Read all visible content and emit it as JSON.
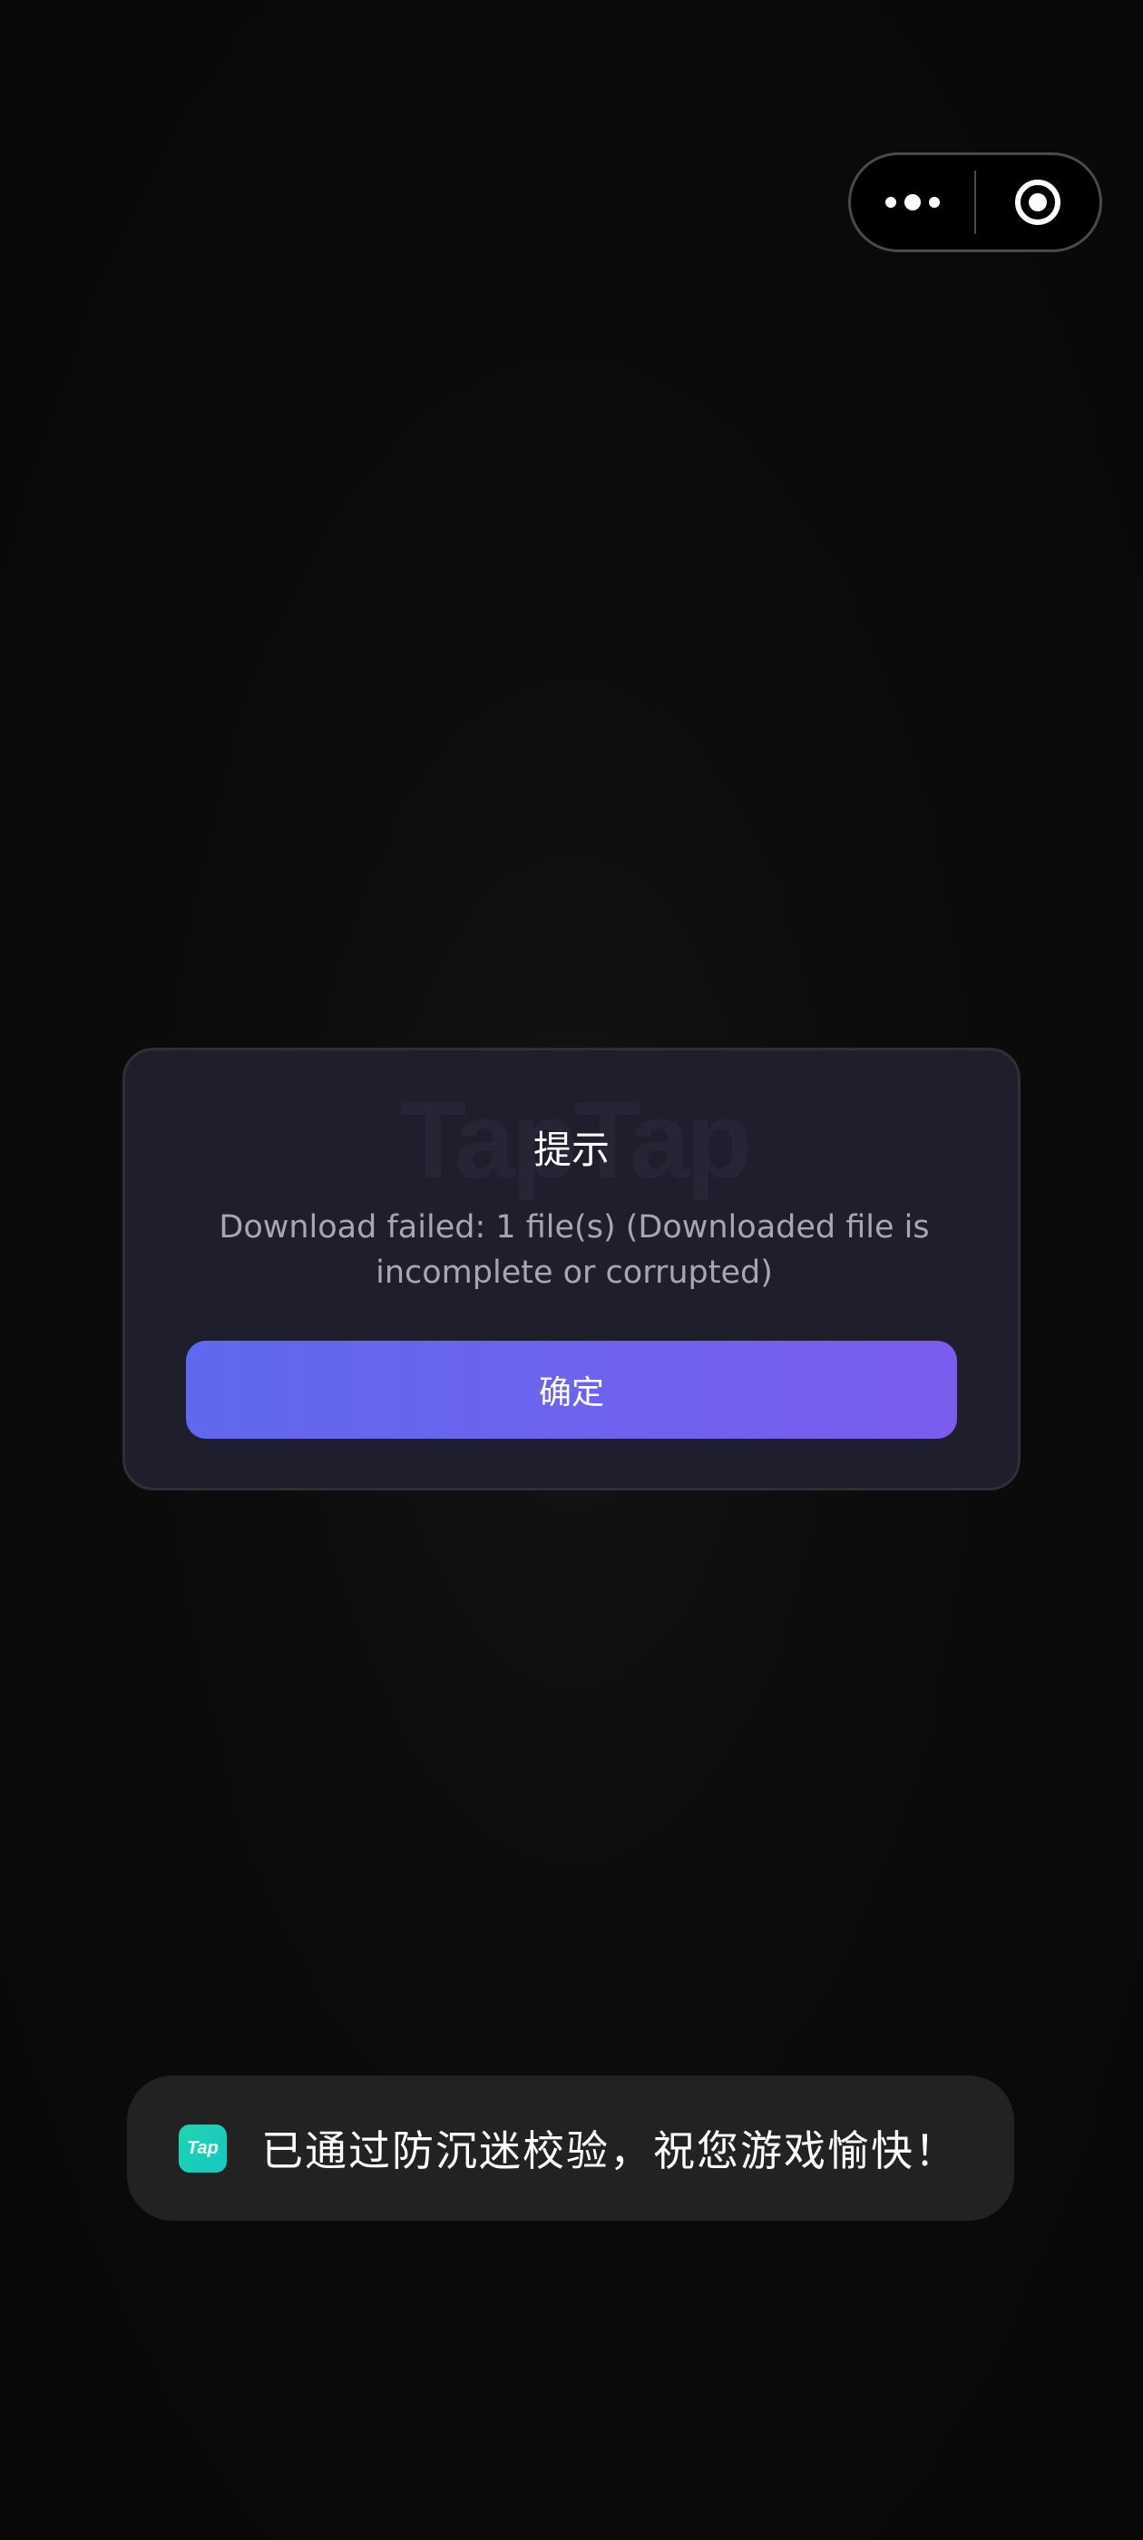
{
  "capsule": {
    "more_icon": "more-dots-icon",
    "close_icon": "target-circle-icon"
  },
  "dialog": {
    "watermark": "TapTap",
    "title": "提示",
    "message": "Download failed: 1 file(s) (Downloaded file is incomplete or corrupted)",
    "confirm_label": "确定",
    "accent_gradient": [
      "#6068f0",
      "#7a5cef"
    ]
  },
  "toast": {
    "logo_text": "Tap",
    "message": "已通过防沉迷校验，祝您游戏愉快！",
    "logo_color": "#1ccfbc"
  }
}
